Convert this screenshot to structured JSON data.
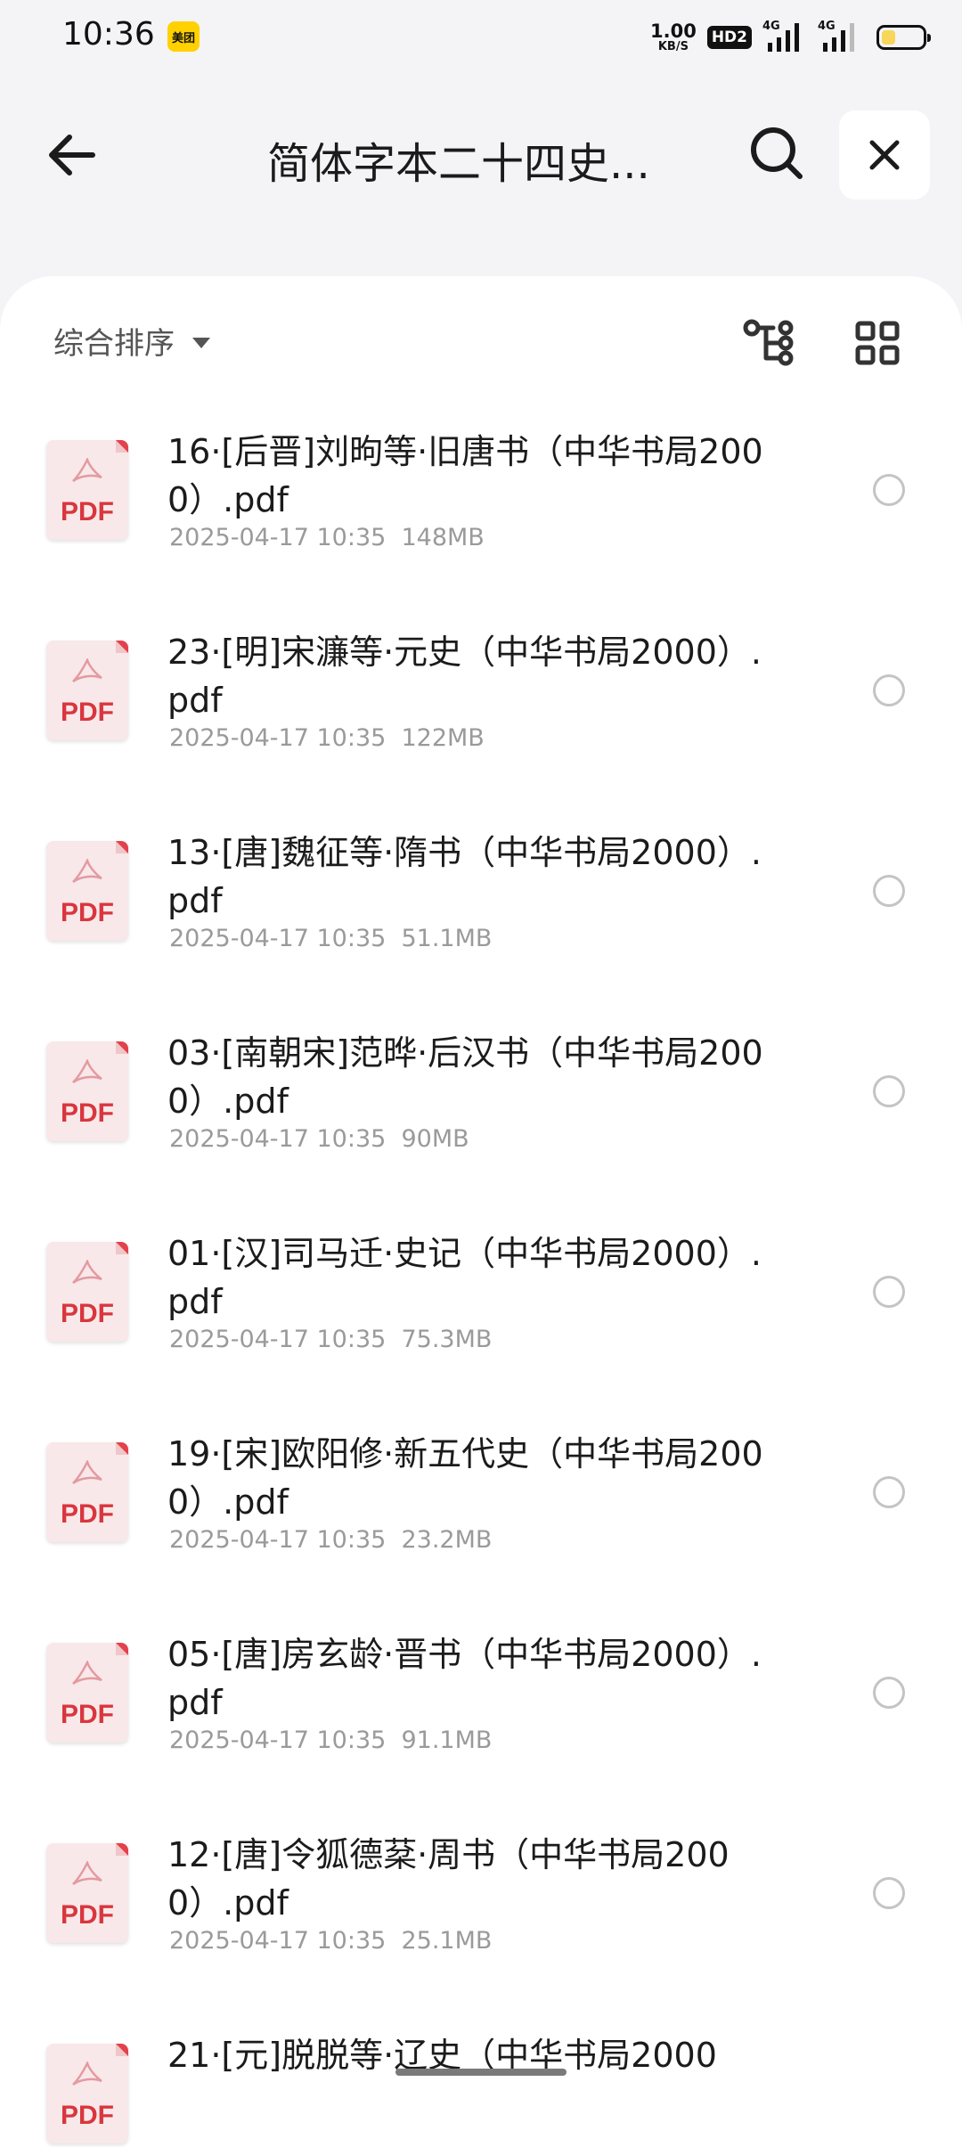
{
  "status_bar": {
    "time": "10:36",
    "app_badge": "美团",
    "net_speed_value": "1.00",
    "net_speed_unit": "KB/S",
    "hd_badge": "HD2",
    "signal1_label": "4G",
    "signal2_label": "4G",
    "battery_level": 0.35
  },
  "header": {
    "title": "简体字本二十四史...",
    "back_icon": "arrow-left-icon",
    "search_icon": "search-icon",
    "close_icon": "close-icon"
  },
  "sort_bar": {
    "label": "综合排序",
    "tree_icon": "tree-view-icon",
    "grid_icon": "grid-view-icon"
  },
  "files": [
    {
      "name": "16·[后晋]刘昫等·旧唐书（中华书局2000）.pdf",
      "meta": "2025-04-17 10:35  148MB",
      "icon_label": "PDF"
    },
    {
      "name": "23·[明]宋濂等·元史（中华书局2000）.pdf",
      "meta": "2025-04-17 10:35  122MB",
      "icon_label": "PDF"
    },
    {
      "name": "13·[唐]魏征等·隋书（中华书局2000）.pdf",
      "meta": "2025-04-17 10:35  51.1MB",
      "icon_label": "PDF"
    },
    {
      "name": "03·[南朝宋]范晔·后汉书（中华书局2000）.pdf",
      "meta": "2025-04-17 10:35  90MB",
      "icon_label": "PDF"
    },
    {
      "name": "01·[汉]司马迁·史记（中华书局2000）.pdf",
      "meta": "2025-04-17 10:35  75.3MB",
      "icon_label": "PDF"
    },
    {
      "name": "19·[宋]欧阳修·新五代史（中华书局2000）.pdf",
      "meta": "2025-04-17 10:35  23.2MB",
      "icon_label": "PDF"
    },
    {
      "name": "05·[唐]房玄龄·晋书（中华书局2000）.pdf",
      "meta": "2025-04-17 10:35  91.1MB",
      "icon_label": "PDF"
    },
    {
      "name": "12·[唐]令狐德棻·周书（中华书局2000）.pdf",
      "meta": "2025-04-17 10:35  25.1MB",
      "icon_label": "PDF"
    },
    {
      "name": "21·[元]脱脱等·辽史（中华书局2000",
      "meta": "",
      "icon_label": "PDF"
    }
  ]
}
